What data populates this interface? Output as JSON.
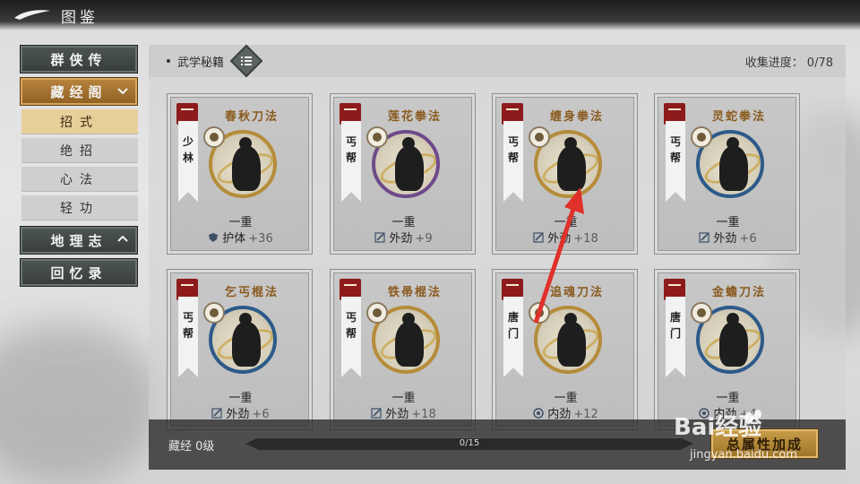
{
  "header": {
    "title": "图鉴"
  },
  "sidebar": {
    "items": [
      {
        "label": "群侠传"
      },
      {
        "label": "藏经阁"
      },
      {
        "label": "地理志"
      },
      {
        "label": "回忆录"
      }
    ],
    "subitems": [
      {
        "label": "招式"
      },
      {
        "label": "绝招"
      },
      {
        "label": "心法"
      },
      {
        "label": "轻功"
      }
    ]
  },
  "main": {
    "section_title": "武学秘籍",
    "progress_label": "收集进度：",
    "progress_value": "0/78",
    "cards": [
      {
        "name": "春秋刀法",
        "sect": "少林",
        "level": "一重",
        "stat": "护体",
        "bonus": "+36",
        "stat_icon": "shield-icon",
        "ring_color": "#b58c3a"
      },
      {
        "name": "莲花拳法",
        "sect": "丐帮",
        "level": "一重",
        "stat": "外劲",
        "bonus": "+9",
        "stat_icon": "sword-icon",
        "ring_color": "#6f4a8a"
      },
      {
        "name": "缠身拳法",
        "sect": "丐帮",
        "level": "一重",
        "stat": "外劲",
        "bonus": "+18",
        "stat_icon": "sword-icon",
        "ring_color": "#b58c3a"
      },
      {
        "name": "灵蛇拳法",
        "sect": "丐帮",
        "level": "一重",
        "stat": "外劲",
        "bonus": "+6",
        "stat_icon": "sword-icon",
        "ring_color": "#2d5a8a"
      },
      {
        "name": "乞丐棍法",
        "sect": "丐帮",
        "level": "一重",
        "stat": "外劲",
        "bonus": "+6",
        "stat_icon": "sword-icon",
        "ring_color": "#2d5a8a"
      },
      {
        "name": "铁帚棍法",
        "sect": "丐帮",
        "level": "一重",
        "stat": "外劲",
        "bonus": "+18",
        "stat_icon": "sword-icon",
        "ring_color": "#b58c3a"
      },
      {
        "name": "追魂刀法",
        "sect": "唐门",
        "level": "一重",
        "stat": "内劲",
        "bonus": "+12",
        "stat_icon": "swirl-icon",
        "ring_color": "#b58c3a"
      },
      {
        "name": "金蟾刀法",
        "sect": "唐门",
        "level": "一重",
        "stat": "内劲",
        "bonus": "+4",
        "stat_icon": "swirl-icon",
        "ring_color": "#2d5a8a"
      }
    ]
  },
  "bottom": {
    "label": "藏经 0级",
    "count": "0/15",
    "progress": 0,
    "bonus_button": "总属性加成"
  },
  "watermark": {
    "brand": "Bai经验",
    "url": "jingyan.baidu.com"
  }
}
